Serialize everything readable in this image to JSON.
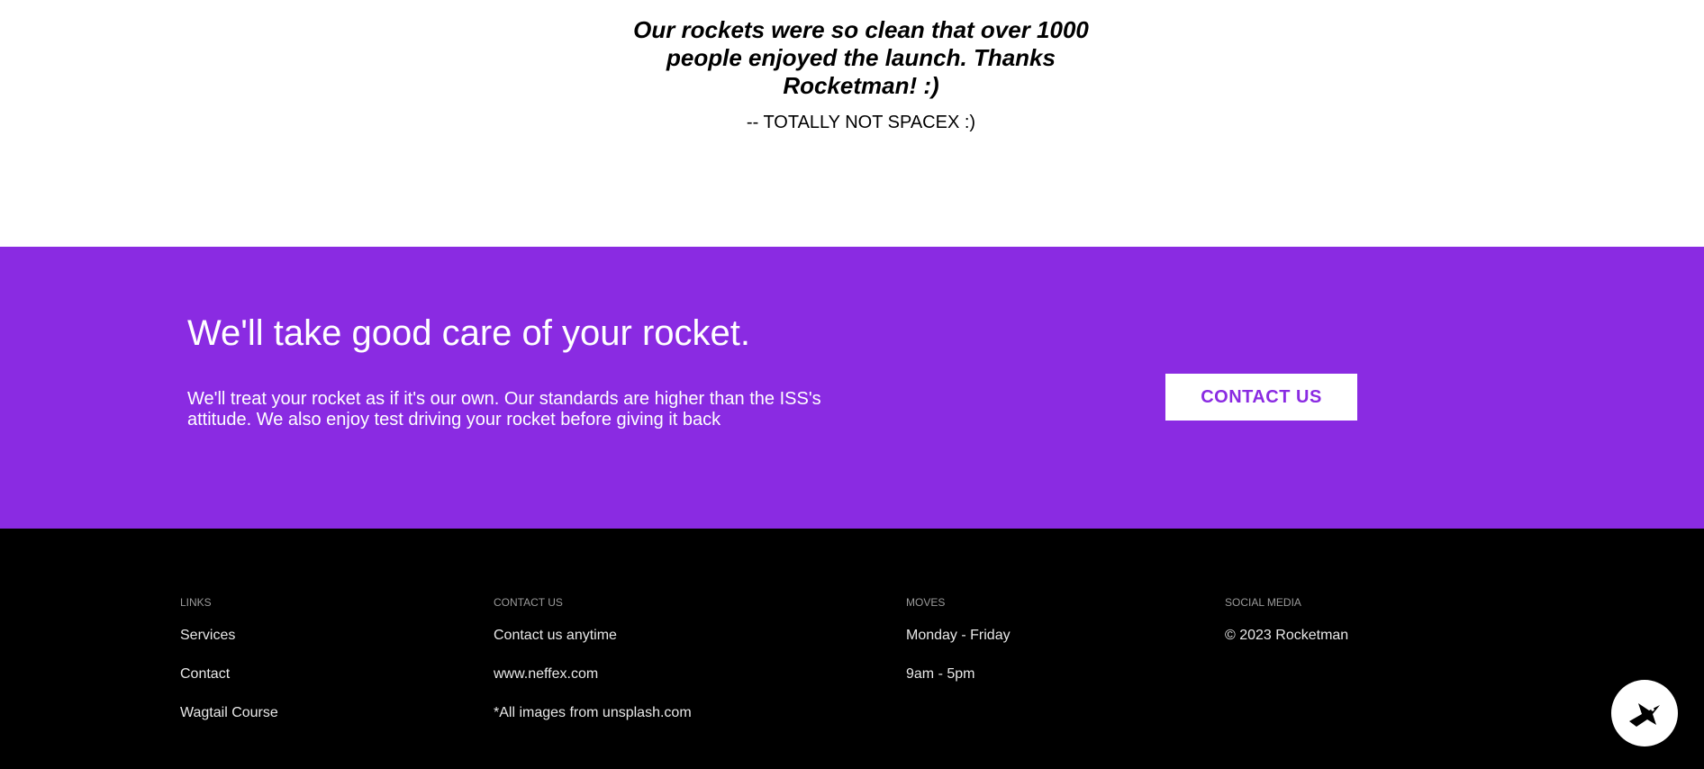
{
  "testimonial": {
    "quote": "Our rockets were so clean that over 1000 people enjoyed the launch. Thanks Rocketman! :)",
    "attribution": "-- TOTALLY NOT SPACEX :)"
  },
  "cta": {
    "title": "We'll take good care of your rocket.",
    "text": "We'll treat your rocket as if it's our own. Our standards are higher than the ISS's attitude. We also enjoy test driving your rocket before giving it back",
    "button_label": "CONTACT US",
    "background_color": "#8a2be2"
  },
  "footer": {
    "links": {
      "heading": "LINKS",
      "items": [
        "Services",
        "Contact",
        "Wagtail Course"
      ]
    },
    "contact": {
      "heading": "CONTACT US",
      "items": [
        "Contact us anytime",
        "www.neffex.com",
        "*All images from unsplash.com"
      ]
    },
    "moves": {
      "heading": "MOVES",
      "items": [
        "Monday - Friday",
        "9am - 5pm"
      ]
    },
    "social": {
      "heading": "SOCIAL MEDIA",
      "items": [
        "© 2023 Rocketman"
      ]
    }
  },
  "chat_widget": {
    "icon": "bird-icon"
  }
}
